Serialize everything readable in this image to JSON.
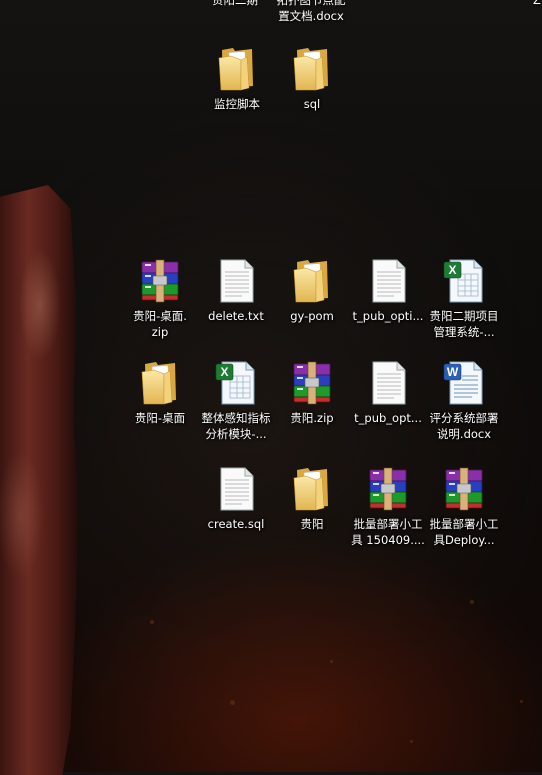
{
  "desktop": {
    "clipped_top": [
      {
        "label": "贵阳二期",
        "icon": "folder-icon"
      },
      {
        "label": "拓扑图节点配\n置文档.docx",
        "icon": "word-doc-icon"
      },
      {
        "label": "Z",
        "icon": "unknown"
      }
    ],
    "items": [
      {
        "label": "监控脚本",
        "icon": "folder-icon"
      },
      {
        "label": "sql",
        "icon": "folder-icon"
      },
      {
        "label": "贵阳-桌面.\nzip",
        "icon": "winrar-archive-icon"
      },
      {
        "label": "delete.txt",
        "icon": "text-file-icon"
      },
      {
        "label": "gy-pom",
        "icon": "folder-icon"
      },
      {
        "label": "t_pub_opti...",
        "icon": "text-file-icon"
      },
      {
        "label": "贵阳二期项目\n管理系统-...",
        "icon": "excel-file-icon"
      },
      {
        "label": "贵阳-桌面",
        "icon": "folder-icon"
      },
      {
        "label": "整体感知指标\n分析模块-...",
        "icon": "excel-file-icon"
      },
      {
        "label": "贵阳.zip",
        "icon": "winrar-archive-icon"
      },
      {
        "label": "t_pub_opt...",
        "icon": "text-file-icon"
      },
      {
        "label": "评分系统部署\n说明.docx",
        "icon": "word-doc-icon"
      },
      {
        "label": "create.sql",
        "icon": "text-file-icon"
      },
      {
        "label": "贵阳",
        "icon": "folder-icon"
      },
      {
        "label": "批量部署小工\n具 150409....",
        "icon": "winrar-archive-icon"
      },
      {
        "label": "批量部署小工\n具Deploy...",
        "icon": "winrar-archive-icon"
      }
    ]
  }
}
